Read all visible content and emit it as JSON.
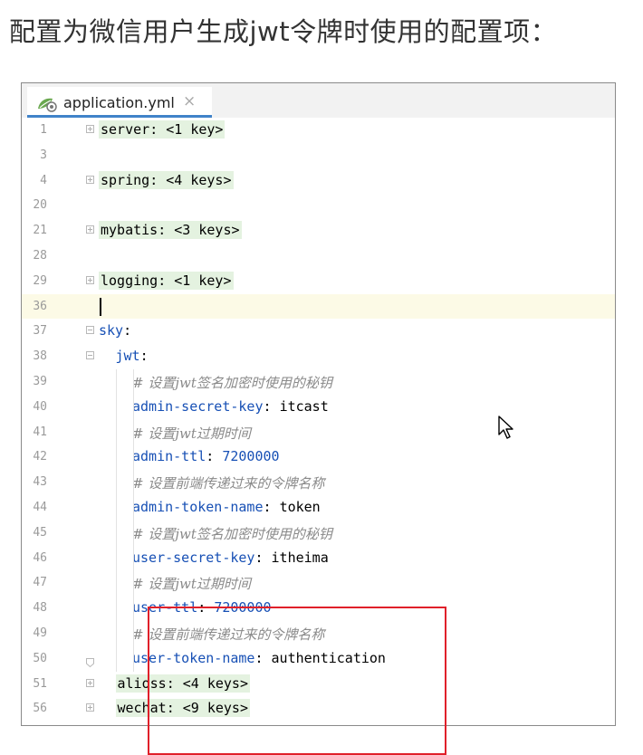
{
  "heading": "配置为微信用户生成jwt令牌时使用的配置项：",
  "editor": {
    "tab": {
      "label": "application.yml",
      "close": "×"
    },
    "lines": [
      {
        "num": "1",
        "fold": "plus",
        "indent": 0,
        "type": "collapsed",
        "key": "server",
        "value": "<1 key>"
      },
      {
        "num": "3",
        "fold": "",
        "indent": 0,
        "type": "empty"
      },
      {
        "num": "4",
        "fold": "plus",
        "indent": 0,
        "type": "collapsed",
        "key": "spring",
        "value": "<4 keys>"
      },
      {
        "num": "20",
        "fold": "",
        "indent": 0,
        "type": "empty"
      },
      {
        "num": "21",
        "fold": "plus",
        "indent": 0,
        "type": "collapsed",
        "key": "mybatis",
        "value": "<3 keys>"
      },
      {
        "num": "28",
        "fold": "",
        "indent": 0,
        "type": "empty"
      },
      {
        "num": "29",
        "fold": "plus",
        "indent": 0,
        "type": "collapsed",
        "key": "logging",
        "value": "<1 key>"
      },
      {
        "num": "36",
        "fold": "",
        "indent": 0,
        "type": "caret",
        "current": true
      },
      {
        "num": "37",
        "fold": "minus",
        "indent": 0,
        "type": "kv",
        "key": "sky",
        "value": ""
      },
      {
        "num": "38",
        "fold": "minus",
        "indent": 1,
        "type": "kv",
        "key": "jwt",
        "value": ""
      },
      {
        "num": "39",
        "fold": "",
        "indent": 2,
        "type": "comment",
        "text": "# 设置jwt签名加密时使用的秘钥"
      },
      {
        "num": "40",
        "fold": "",
        "indent": 2,
        "type": "kv",
        "key": "admin-secret-key",
        "value": "itcast",
        "vtype": "str"
      },
      {
        "num": "41",
        "fold": "",
        "indent": 2,
        "type": "comment",
        "text": "# 设置jwt过期时间"
      },
      {
        "num": "42",
        "fold": "",
        "indent": 2,
        "type": "kv",
        "key": "admin-ttl",
        "value": "7200000",
        "vtype": "num"
      },
      {
        "num": "43",
        "fold": "",
        "indent": 2,
        "type": "comment",
        "text": "# 设置前端传递过来的令牌名称"
      },
      {
        "num": "44",
        "fold": "",
        "indent": 2,
        "type": "kv",
        "key": "admin-token-name",
        "value": "token",
        "vtype": "str"
      },
      {
        "num": "45",
        "fold": "",
        "indent": 2,
        "type": "comment",
        "text": "# 设置jwt签名加密时使用的秘钥"
      },
      {
        "num": "46",
        "fold": "",
        "indent": 2,
        "type": "kv",
        "key": "user-secret-key",
        "value": "itheima",
        "vtype": "str"
      },
      {
        "num": "47",
        "fold": "",
        "indent": 2,
        "type": "comment",
        "text": "# 设置jwt过期时间"
      },
      {
        "num": "48",
        "fold": "",
        "indent": 2,
        "type": "kv",
        "key": "user-ttl",
        "value": "7200000",
        "vtype": "num"
      },
      {
        "num": "49",
        "fold": "",
        "indent": 2,
        "type": "comment",
        "text": "# 设置前端传递过来的令牌名称"
      },
      {
        "num": "50",
        "fold": "end",
        "indent": 2,
        "type": "kv",
        "key": "user-token-name",
        "value": "authentication",
        "vtype": "str"
      },
      {
        "num": "51",
        "fold": "plus",
        "indent": 1,
        "type": "collapsed",
        "key": "alioss",
        "value": "<4 keys>"
      },
      {
        "num": "56",
        "fold": "plus",
        "indent": 1,
        "type": "collapsed",
        "key": "wechat",
        "value": "<9 keys>"
      }
    ]
  },
  "colors": {
    "key": "#1750b5",
    "comment": "#8a8a8a",
    "collapsed_bg": "#e4f2e0",
    "current_line": "#fcfae6",
    "highlight_box": "#e0202a",
    "tab_underline": "#4083c9"
  },
  "icons": {
    "file": "spring-yaml-file-icon",
    "pointer": "mouse-pointer-icon"
  }
}
